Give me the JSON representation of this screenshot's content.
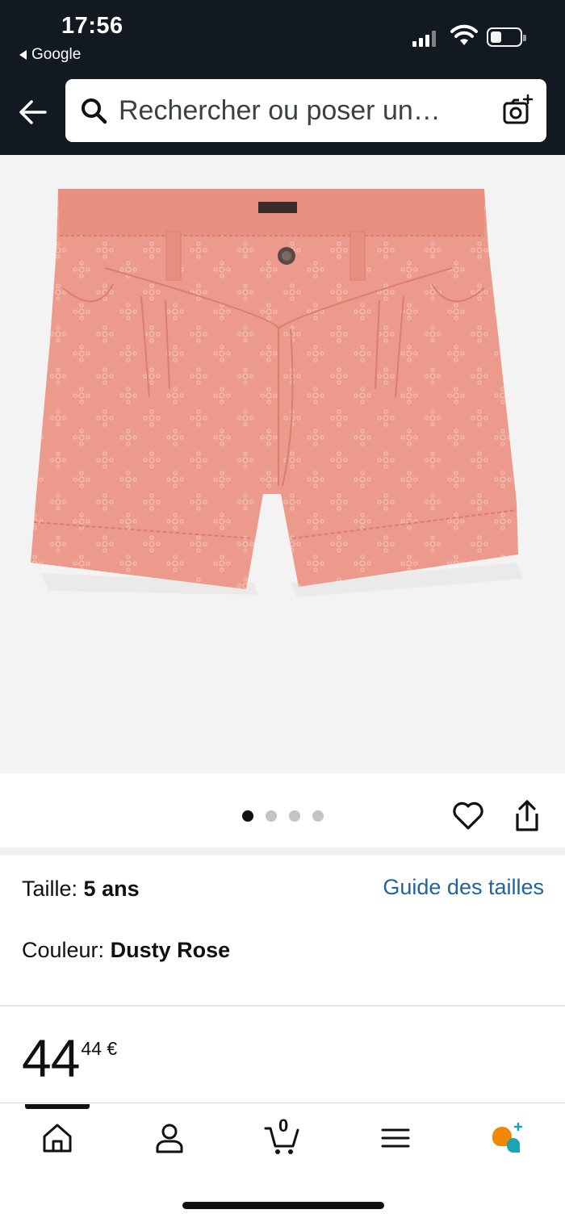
{
  "status_bar": {
    "time": "17:56",
    "back_app": "Google"
  },
  "search": {
    "placeholder": "Rechercher ou poser un…"
  },
  "product": {
    "image_description_icon": "shorts-image",
    "image_count": 4,
    "current_image": 1
  },
  "variation": {
    "size_label": "Taille:",
    "size_value": "5 ans",
    "size_guide": "Guide des tailles",
    "color_label": "Couleur:",
    "color_value": "Dusty Rose"
  },
  "price": {
    "whole": "44",
    "fraction": "44 €"
  },
  "tabs": [
    "home-icon",
    "account-icon",
    "cart-icon",
    "menu-icon",
    "rufus-icon"
  ],
  "cart_count": "0",
  "colors": {
    "header": "#131921",
    "link": "#2162a1",
    "shorts": "#ec9a8c",
    "accent_orange": "#f08804",
    "accent_teal": "#1ba3b8"
  }
}
